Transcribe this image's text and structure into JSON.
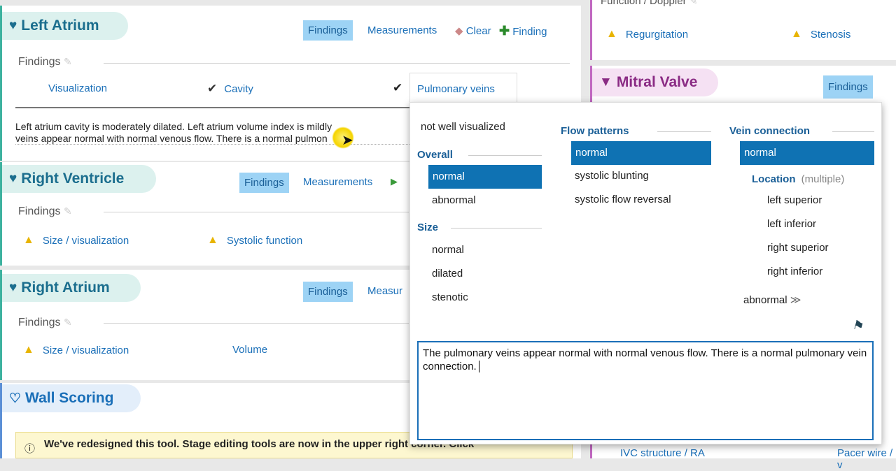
{
  "left_atrium": {
    "title": "Left Atrium",
    "toolbar": {
      "findings": "Findings",
      "measurements": "Measurements",
      "clear": "Clear",
      "finding": "Finding"
    },
    "section_label": "Findings",
    "items": [
      "Visualization",
      "Cavity"
    ],
    "summary_line1": "Left atrium cavity is moderately dilated. Left atrium volume index is mildly",
    "summary_line2": "veins appear normal with normal venous flow. There is a normal pulmon"
  },
  "right_ventricle": {
    "title": "Right Ventricle",
    "toolbar": {
      "findings": "Findings",
      "measurements": "Measurements"
    },
    "section_label": "Findings",
    "items": [
      "Size / visualization",
      "Systolic function"
    ]
  },
  "right_atrium": {
    "title": "Right Atrium",
    "toolbar": {
      "findings": "Findings",
      "measurements": "Measur"
    },
    "section_label": "Findings",
    "items": [
      "Size / visualization",
      "Volume"
    ]
  },
  "wall_scoring": {
    "title": "Wall Scoring",
    "notice": "We've redesigned this tool. Stage editing tools are now in the upper right corner. Click"
  },
  "right_column": {
    "function_doppler": "Function / Doppler",
    "regurgitation": "Regurgitation",
    "stenosis": "Stenosis",
    "mitral_valve": "Mitral Valve",
    "mitral_findings": "Findings",
    "bottom_left": "IVC structure / RA",
    "bottom_right": "Pacer wire / v"
  },
  "popup": {
    "tab": "Pulmonary veins",
    "not_well": "not well visualized",
    "overall_label": "Overall",
    "overall_options": [
      "normal",
      "abnormal"
    ],
    "size_label": "Size",
    "size_options": [
      "normal",
      "dilated",
      "stenotic"
    ],
    "flow_label": "Flow patterns",
    "flow_options": [
      "normal",
      "systolic blunting",
      "systolic flow reversal"
    ],
    "vein_label": "Vein connection",
    "vein_normal": "normal",
    "location_label": "Location",
    "location_hint": "(multiple)",
    "location_options": [
      "left superior",
      "left inferior",
      "right superior",
      "right inferior"
    ],
    "vein_abnormal": "abnormal",
    "text": "The pulmonary veins appear normal with normal venous flow. There is a normal pulmonary vein connection."
  },
  "colors": {
    "accent": "#1a6fb8",
    "selected": "#0f72b3",
    "findings_bg": "#9dd3f5",
    "warn": "#e8b400"
  }
}
